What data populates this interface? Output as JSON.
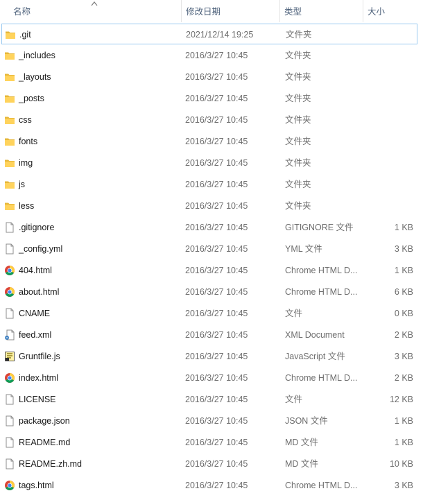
{
  "columns": {
    "name": "名称",
    "date": "修改日期",
    "type": "类型",
    "size": "大小"
  },
  "files": [
    {
      "name": ".git",
      "date": "2021/12/14 19:25",
      "type": "文件夹",
      "size": "",
      "icon": "folder-icon"
    },
    {
      "name": "_includes",
      "date": "2016/3/27 10:45",
      "type": "文件夹",
      "size": "",
      "icon": "folder-icon"
    },
    {
      "name": "_layouts",
      "date": "2016/3/27 10:45",
      "type": "文件夹",
      "size": "",
      "icon": "folder-icon"
    },
    {
      "name": "_posts",
      "date": "2016/3/27 10:45",
      "type": "文件夹",
      "size": "",
      "icon": "folder-icon"
    },
    {
      "name": "css",
      "date": "2016/3/27 10:45",
      "type": "文件夹",
      "size": "",
      "icon": "folder-icon"
    },
    {
      "name": "fonts",
      "date": "2016/3/27 10:45",
      "type": "文件夹",
      "size": "",
      "icon": "folder-icon"
    },
    {
      "name": "img",
      "date": "2016/3/27 10:45",
      "type": "文件夹",
      "size": "",
      "icon": "folder-icon"
    },
    {
      "name": "js",
      "date": "2016/3/27 10:45",
      "type": "文件夹",
      "size": "",
      "icon": "folder-icon"
    },
    {
      "name": "less",
      "date": "2016/3/27 10:45",
      "type": "文件夹",
      "size": "",
      "icon": "folder-icon"
    },
    {
      "name": ".gitignore",
      "date": "2016/3/27 10:45",
      "type": "GITIGNORE 文件",
      "size": "1 KB",
      "icon": "file-icon"
    },
    {
      "name": "_config.yml",
      "date": "2016/3/27 10:45",
      "type": "YML 文件",
      "size": "3 KB",
      "icon": "file-icon"
    },
    {
      "name": "404.html",
      "date": "2016/3/27 10:45",
      "type": "Chrome HTML D...",
      "size": "1 KB",
      "icon": "chrome-icon"
    },
    {
      "name": "about.html",
      "date": "2016/3/27 10:45",
      "type": "Chrome HTML D...",
      "size": "6 KB",
      "icon": "chrome-icon"
    },
    {
      "name": "CNAME",
      "date": "2016/3/27 10:45",
      "type": "文件",
      "size": "0 KB",
      "icon": "file-icon"
    },
    {
      "name": "feed.xml",
      "date": "2016/3/27 10:45",
      "type": "XML Document",
      "size": "2 KB",
      "icon": "xml-file-icon"
    },
    {
      "name": "Gruntfile.js",
      "date": "2016/3/27 10:45",
      "type": "JavaScript 文件",
      "size": "3 KB",
      "icon": "js-file-icon"
    },
    {
      "name": "index.html",
      "date": "2016/3/27 10:45",
      "type": "Chrome HTML D...",
      "size": "2 KB",
      "icon": "chrome-icon"
    },
    {
      "name": "LICENSE",
      "date": "2016/3/27 10:45",
      "type": "文件",
      "size": "12 KB",
      "icon": "file-icon"
    },
    {
      "name": "package.json",
      "date": "2016/3/27 10:45",
      "type": "JSON 文件",
      "size": "1 KB",
      "icon": "file-icon"
    },
    {
      "name": "README.md",
      "date": "2016/3/27 10:45",
      "type": "MD 文件",
      "size": "1 KB",
      "icon": "file-icon"
    },
    {
      "name": "README.zh.md",
      "date": "2016/3/27 10:45",
      "type": "MD 文件",
      "size": "10 KB",
      "icon": "file-icon"
    },
    {
      "name": "tags.html",
      "date": "2016/3/27 10:45",
      "type": "Chrome HTML D...",
      "size": "3 KB",
      "icon": "chrome-icon"
    }
  ],
  "selected_file": ".git"
}
